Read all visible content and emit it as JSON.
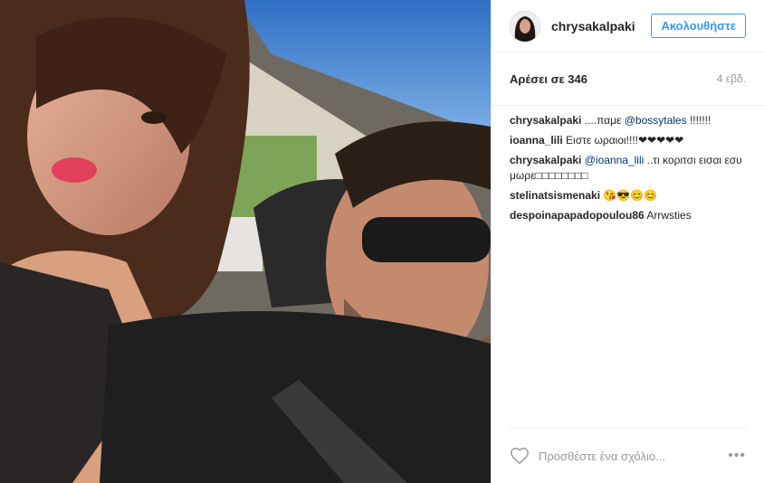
{
  "post": {
    "username": "chrysakalpaki",
    "follow_label": "Ακολουθήστε",
    "likes_text": "Αρέσει σε 346",
    "time_ago": "4 εβδ.",
    "add_comment_placeholder": "Προσθέστε ένα σχόλιο...",
    "more_label": "•••"
  },
  "comments": [
    {
      "user": "chrysakalpaki",
      "text_before": "....παμε ",
      "mention": "@bossytales",
      "text_after": " !!!!!!!"
    },
    {
      "user": "ioanna_lili",
      "text_before": "Ειστε ωραιοι!!!!❤❤❤❤❤",
      "mention": "",
      "text_after": ""
    },
    {
      "user": "chrysakalpaki",
      "text_before": "",
      "mention": "@ioanna_lili",
      "text_after": " ..τι κοριτσι εισαι εσυ μωρε□□□□□□□□"
    },
    {
      "user": "stelinatsismenaki",
      "text_before": "😘😎😊😊",
      "mention": "",
      "text_after": ""
    },
    {
      "user": "despoinapapadopoulou86",
      "text_before": "Arrwsties",
      "mention": "",
      "text_after": ""
    }
  ],
  "colors": {
    "accent": "#3897f0",
    "mention": "#003569",
    "text": "#262626",
    "muted": "#999999"
  }
}
